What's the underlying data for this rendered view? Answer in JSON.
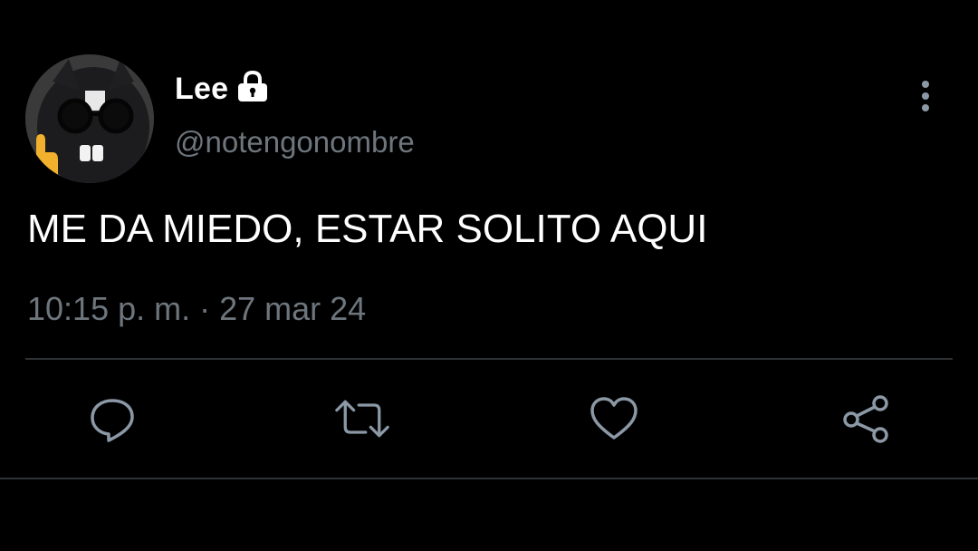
{
  "user": {
    "display_name": "Lee",
    "handle": "@notengonombre",
    "protected_icon": "lock-icon",
    "avatar": "avatar-image"
  },
  "tweet": {
    "text": "ME DA MIEDO, ESTAR SOLITO AQUI",
    "timestamp": "10:15 p. m. · 27 mar 24"
  },
  "actions": [
    {
      "name": "reply",
      "icon": "reply-icon"
    },
    {
      "name": "retweet",
      "icon": "retweet-icon"
    },
    {
      "name": "like",
      "icon": "heart-icon"
    },
    {
      "name": "share",
      "icon": "share-icon"
    }
  ],
  "menu": {
    "icon": "more-vertical-icon"
  },
  "colors": {
    "background": "#000000",
    "text": "#ffffff",
    "secondary": "#6e767d",
    "divider": "#2f3336"
  }
}
